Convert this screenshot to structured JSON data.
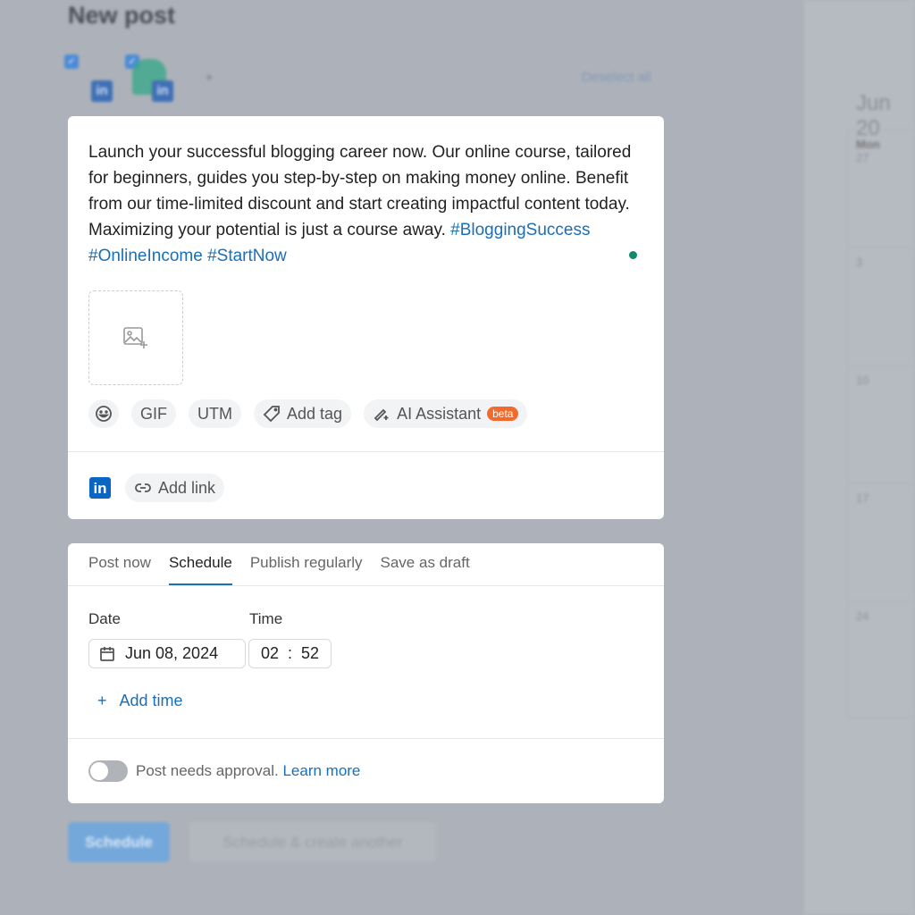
{
  "page": {
    "title": "New post",
    "deselect_all": "Deselect all",
    "add_account": "+"
  },
  "accounts": [
    {
      "network": "LinkedIn",
      "checked": true,
      "icon": "linkedin-icon"
    },
    {
      "network": "LinkedIn",
      "checked": true,
      "icon": "linkedin-icon"
    }
  ],
  "composer": {
    "text": "Launch your successful blogging career now. Our online course, tailored for beginners, guides you step-by-step on making money online. Benefit from our time-limited discount and start creating impactful content today. Maximizing your potential is just a course away.",
    "hashtags": [
      "#BloggingSuccess",
      "#OnlineIncome",
      "#StartNow"
    ],
    "status_color": "#12896b",
    "toolbar": {
      "gif": "GIF",
      "utm": "UTM",
      "add_tag": "Add tag",
      "ai_assistant": "AI Assistant",
      "beta": "beta"
    },
    "add_link": "Add link"
  },
  "schedule": {
    "tabs": [
      {
        "label": "Post now"
      },
      {
        "label": "Schedule",
        "active": true
      },
      {
        "label": "Publish regularly"
      },
      {
        "label": "Save as draft"
      }
    ],
    "date_label": "Date",
    "date_value": "Jun 08, 2024",
    "time_label": "Time",
    "hour": "02",
    "separator": ":",
    "minute": "52",
    "add_time": "Add time",
    "add_time_icon": "+",
    "approval_text": "Post needs approval.",
    "learn_more": "Learn more",
    "approval_enabled": false
  },
  "actions": {
    "schedule": "Schedule",
    "schedule_another": "Schedule & create another"
  },
  "calendar": {
    "title": "Jun 20",
    "day": "Mon",
    "dates": [
      "27",
      "3",
      "10",
      "17",
      "24"
    ]
  },
  "colors": {
    "accent": "#1a6fb5",
    "beta": "#f26b2c",
    "linkedin": "#0a66c2"
  }
}
